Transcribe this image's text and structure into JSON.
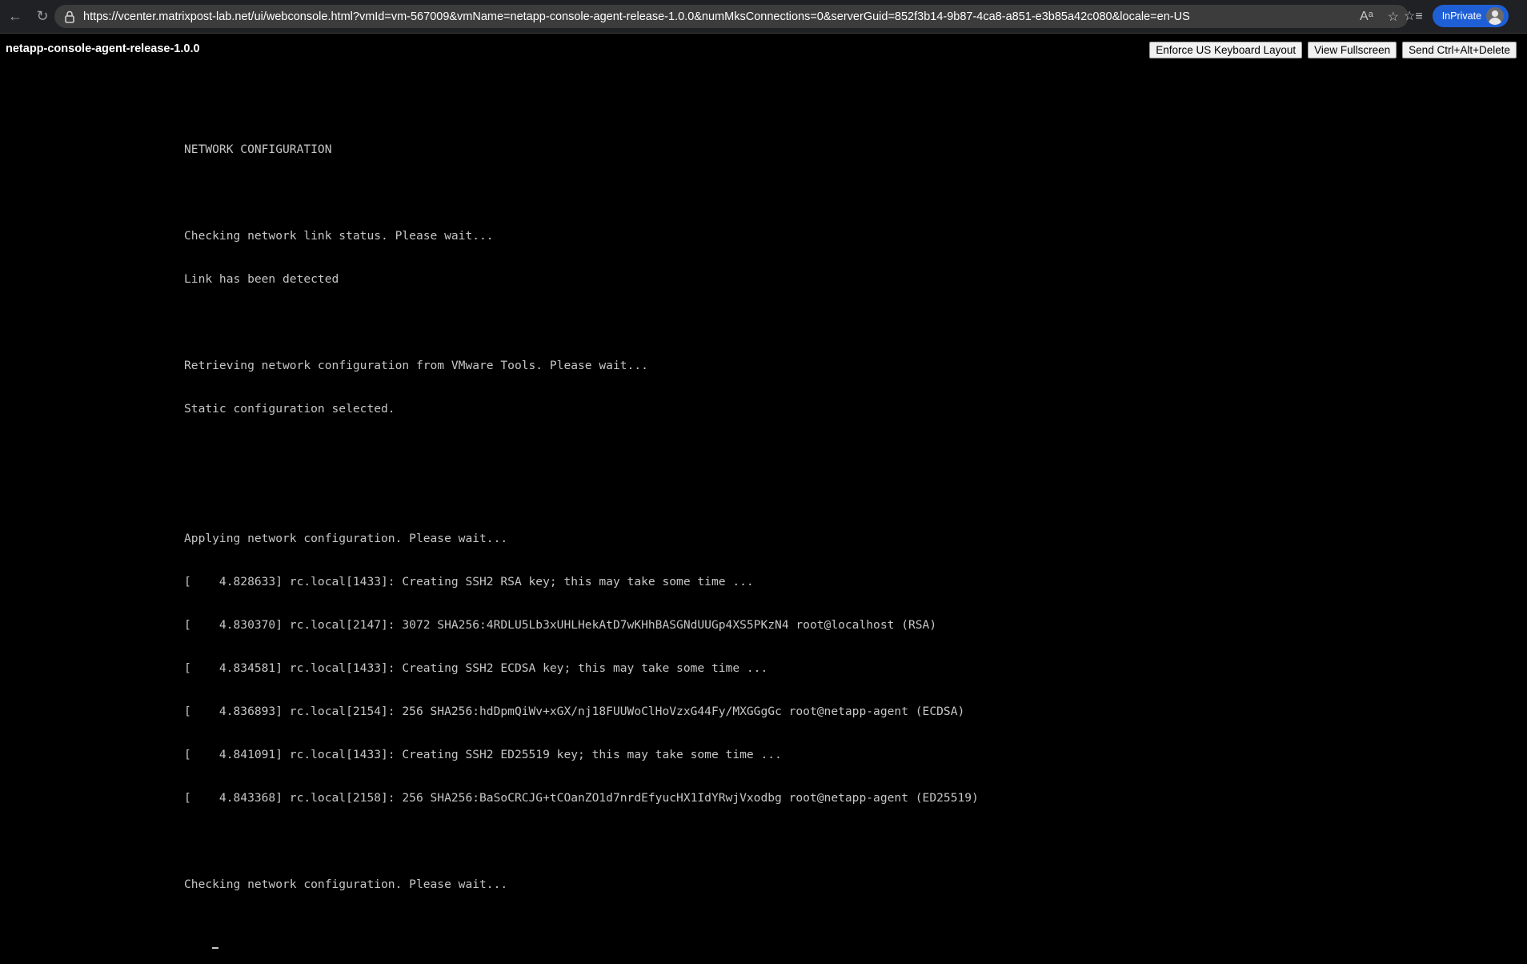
{
  "browser": {
    "url": "https://vcenter.matrixpost-lab.net/ui/webconsole.html?vmId=vm-567009&vmName=netapp-console-agent-release-1.0.0&numMksConnections=0&serverGuid=852f3b14-9b87-4ca8-a851-e3b85a42c080&locale=en-US",
    "inprivate_label": "InPrivate",
    "icons": {
      "back": "back-arrow-icon",
      "reload": "reload-icon",
      "lock": "lock-icon",
      "read_aloud": "read-aloud-icon",
      "favorite": "star-icon",
      "favorites": "favorites-icon",
      "profile": "avatar-icon"
    }
  },
  "console": {
    "vm_name": "netapp-console-agent-release-1.0.0",
    "buttons": {
      "keyboard": "Enforce US Keyboard Layout",
      "fullscreen": "View Fullscreen",
      "cad": "Send Ctrl+Alt+Delete"
    }
  },
  "terminal": {
    "lines": [
      "NETWORK CONFIGURATION",
      "",
      "Checking network link status. Please wait...",
      "Link has been detected",
      "",
      "Retrieving network configuration from VMware Tools. Please wait...",
      "Static configuration selected.",
      "",
      "",
      "Applying network configuration. Please wait...",
      "[    4.828633] rc.local[1433]: Creating SSH2 RSA key; this may take some time ...",
      "[    4.830370] rc.local[2147]: 3072 SHA256:4RDLU5Lb3xUHLHekAtD7wKHhBASGNdUUGp4XS5PKzN4 root@localhost (RSA)",
      "[    4.834581] rc.local[1433]: Creating SSH2 ECDSA key; this may take some time ...",
      "[    4.836893] rc.local[2154]: 256 SHA256:hdDpmQiWv+xGX/nj18FUUWoClHoVzxG44Fy/MXGGgGc root@netapp-agent (ECDSA)",
      "[    4.841091] rc.local[1433]: Creating SSH2 ED25519 key; this may take some time ...",
      "[    4.843368] rc.local[2158]: 256 SHA256:BaSoCRCJG+tCOanZO1d7nrdEfyucHX1IdYRwjVxodbg root@netapp-agent (ED25519)",
      "",
      "Checking network configuration. Please wait..."
    ]
  }
}
